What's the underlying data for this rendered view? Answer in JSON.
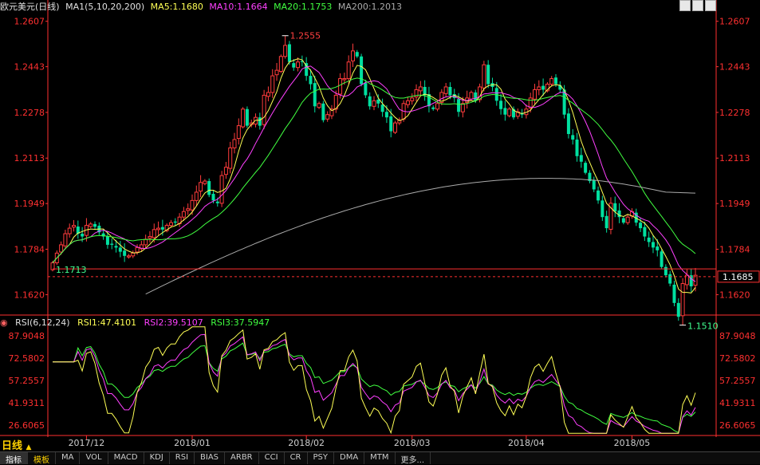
{
  "header": {
    "title": "欧元美元(日线)",
    "ma_group": "MA1(5,10,20,200)",
    "ma5": "MA5:1.1680",
    "ma10": "MA10:1.1664",
    "ma20": "MA20:1.1753",
    "ma200": "MA200:1.2013"
  },
  "rsi_header": {
    "title": "RSI(6,12,24)",
    "rsi1": "RSI1:47.4101",
    "rsi2": "RSI2:39.5107",
    "rsi3": "RSI3:37.5947"
  },
  "price_axis_labels": [
    "1.2607",
    "1.2443",
    "1.2278",
    "1.2113",
    "1.1949",
    "1.1784",
    "1.1620"
  ],
  "current_price_tag": "1.1685",
  "marker_labels": {
    "high": "1.2555",
    "low": "1.1510",
    "ref": "1.1713"
  },
  "rsi_axis_labels": [
    "87.9048",
    "72.5802",
    "57.2557",
    "41.9311",
    "26.6065"
  ],
  "date_labels": [
    "2017/12",
    "2018/01",
    "2018/02",
    "2018/03",
    "2018/04",
    "2018/05"
  ],
  "mode_label": "日线",
  "mode_arrow": "▲",
  "tabs": [
    "指标",
    "模板",
    "MA",
    "VOL",
    "MACD",
    "KDJ",
    "RSI",
    "BIAS",
    "ARBR",
    "CCI",
    "CR",
    "PSY",
    "DMA",
    "MTM",
    "更多..."
  ],
  "colors": {
    "up": "#ff3c3c",
    "down": "#00e0a0",
    "ma5": "#ffff55",
    "ma10": "#ff40ff",
    "ma20": "#40ff40",
    "ma200": "#aaaaaa",
    "axis": "#ff3030",
    "rsi1": "#ffff55",
    "rsi2": "#ff40ff",
    "rsi3": "#40ff40"
  },
  "chart_data": [
    {
      "type": "candlestick",
      "title": "欧元美元(日线)",
      "ylim": [
        1.151,
        1.2607
      ],
      "y_ticks": [
        1.2607,
        1.2443,
        1.2278,
        1.2113,
        1.1949,
        1.1784,
        1.162
      ],
      "x_period_labels": [
        "2017/12",
        "2018/01",
        "2018/02",
        "2018/03",
        "2018/04",
        "2018/05"
      ],
      "annotations": [
        {
          "label": "1.2555",
          "value": 1.2555,
          "kind": "high"
        },
        {
          "label": "1.1510",
          "value": 1.151,
          "kind": "low"
        },
        {
          "label": "1.1713",
          "value": 1.1713,
          "kind": "reference"
        }
      ],
      "current_price": 1.1685,
      "close": [
        1.1735,
        1.177,
        1.18,
        1.184,
        1.186,
        1.187,
        1.184,
        1.183,
        1.187,
        1.1875,
        1.1865,
        1.1845,
        1.183,
        1.18,
        1.18,
        1.179,
        1.1775,
        1.176,
        1.176,
        1.177,
        1.179,
        1.18,
        1.182,
        1.183,
        1.1855,
        1.186,
        1.1855,
        1.187,
        1.188,
        1.188,
        1.19,
        1.192,
        1.193,
        1.196,
        1.199,
        1.2025,
        1.203,
        1.198,
        1.196,
        1.195,
        1.205,
        1.208,
        1.215,
        1.218,
        1.223,
        1.229,
        1.223,
        1.224,
        1.226,
        1.223,
        1.234,
        1.235,
        1.241,
        1.243,
        1.248,
        1.252,
        1.246,
        1.244,
        1.246,
        1.246,
        1.241,
        1.238,
        1.23,
        1.231,
        1.225,
        1.227,
        1.229,
        1.234,
        1.24,
        1.24,
        1.246,
        1.25,
        1.248,
        1.238,
        1.234,
        1.23,
        1.232,
        1.231,
        1.228,
        1.226,
        1.221,
        1.224,
        1.225,
        1.231,
        1.232,
        1.233,
        1.236,
        1.237,
        1.234,
        1.23,
        1.229,
        1.231,
        1.235,
        1.237,
        1.234,
        1.233,
        1.228,
        1.231,
        1.233,
        1.235,
        1.232,
        1.237,
        1.245,
        1.238,
        1.237,
        1.232,
        1.229,
        1.227,
        1.229,
        1.226,
        1.228,
        1.227,
        1.229,
        1.233,
        1.236,
        1.237,
        1.236,
        1.238,
        1.24,
        1.238,
        1.236,
        1.227,
        1.22,
        1.218,
        1.212,
        1.21,
        1.206,
        1.203,
        1.2,
        1.196,
        1.19,
        1.186,
        1.195,
        1.192,
        1.19,
        1.188,
        1.19,
        1.192,
        1.188,
        1.186,
        1.183,
        1.181,
        1.179,
        1.178,
        1.172,
        1.169,
        1.166,
        1.159,
        1.154,
        1.166,
        1.169,
        1.165,
        1.169
      ],
      "series": [
        {
          "name": "MA5",
          "last": 1.168
        },
        {
          "name": "MA10",
          "last": 1.1664
        },
        {
          "name": "MA20",
          "last": 1.1753
        },
        {
          "name": "MA200",
          "last": 1.2013
        }
      ]
    },
    {
      "type": "line",
      "title": "RSI(6,12,24)",
      "ylim": [
        26.6065,
        87.9048
      ],
      "y_ticks": [
        87.9048,
        72.5802,
        57.2557,
        41.9311,
        26.6065
      ],
      "series": [
        {
          "name": "RSI1",
          "last": 47.4101
        },
        {
          "name": "RSI2",
          "last": 39.5107
        },
        {
          "name": "RSI3",
          "last": 37.5947
        }
      ]
    }
  ]
}
